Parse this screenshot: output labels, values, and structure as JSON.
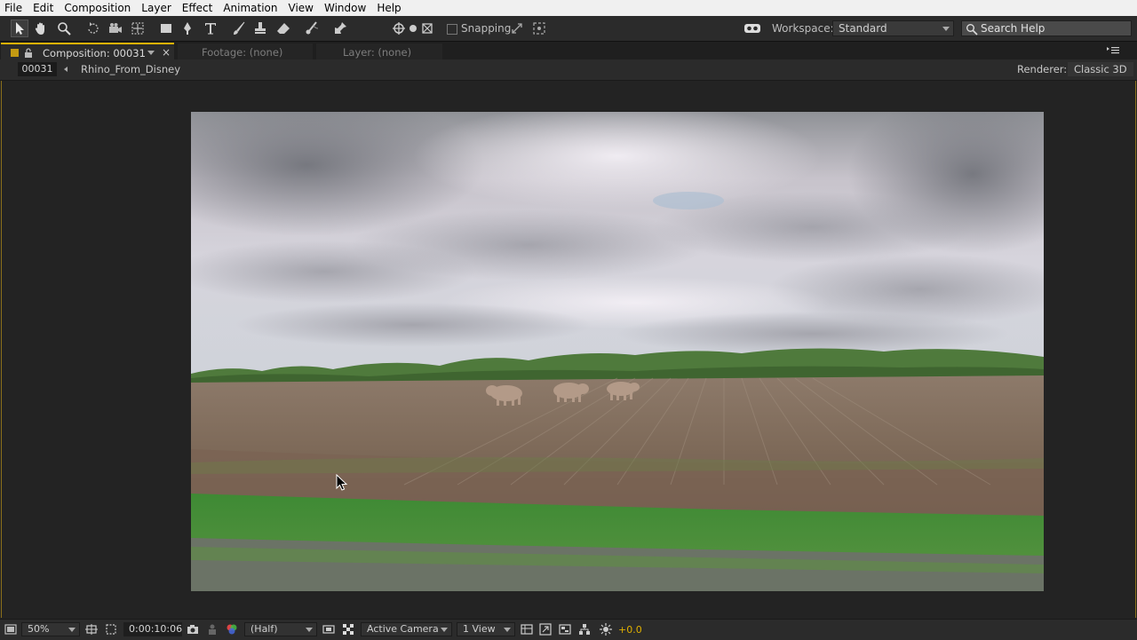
{
  "menu": [
    "File",
    "Edit",
    "Composition",
    "Layer",
    "Effect",
    "Animation",
    "View",
    "Window",
    "Help"
  ],
  "toolbar": {
    "snapping_label": "Snapping",
    "workspace_label": "Workspace:",
    "workspace_value": "Standard",
    "search_placeholder": "Search Help"
  },
  "tabs": {
    "composition": "Composition: 00031",
    "footage": "Footage: (none)",
    "layer": "Layer: (none)"
  },
  "subbar": {
    "comp_id": "00031",
    "comp_name": "Rhino_From_Disney",
    "renderer_label": "Renderer:",
    "renderer_value": "Classic 3D"
  },
  "viewer": {
    "scene": "field-with-three-rhinos"
  },
  "bottombar": {
    "zoom": "50%",
    "timecode": "0:00:10:06",
    "resolution": "(Half)",
    "camera": "Active Camera",
    "views": "1 View",
    "exposure": "+0.0"
  },
  "colors": {
    "accent": "#e2b200",
    "panel_bg": "#232323",
    "menubar_bg": "#f0f0f0"
  }
}
